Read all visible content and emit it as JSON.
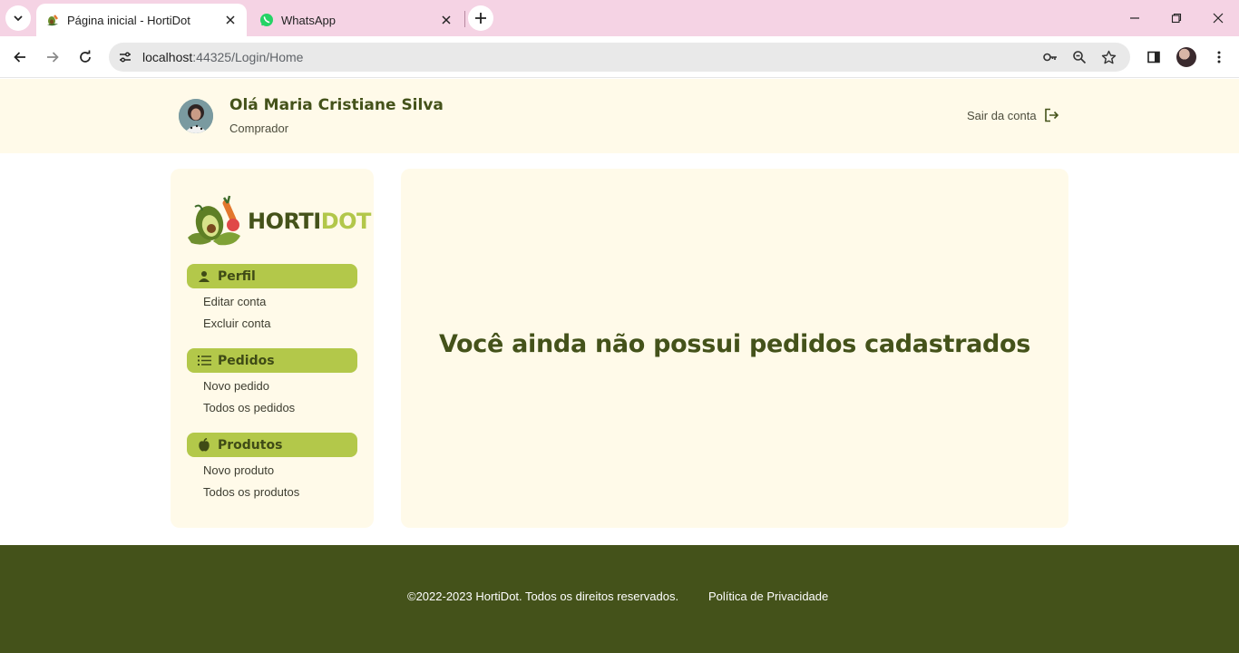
{
  "browser": {
    "tabs": [
      {
        "title": "Página inicial - HortiDot",
        "active": true,
        "icon": "hortidot-favicon"
      },
      {
        "title": "WhatsApp",
        "active": false,
        "icon": "whatsapp-icon"
      }
    ],
    "address": {
      "host": "localhost",
      "rest": ":44325/Login/Home"
    }
  },
  "header": {
    "greeting": "Olá Maria Cristiane Silva",
    "role": "Comprador",
    "logout_label": "Sair da conta"
  },
  "sidebar": {
    "logo": {
      "part1": "HORTI",
      "part2": "DOT"
    },
    "sections": [
      {
        "label": "Perfil",
        "icon": "user-icon",
        "items": [
          "Editar conta",
          "Excluir conta"
        ]
      },
      {
        "label": "Pedidos",
        "icon": "list-icon",
        "items": [
          "Novo pedido",
          "Todos os pedidos"
        ]
      },
      {
        "label": "Produtos",
        "icon": "apple-icon",
        "items": [
          "Novo produto",
          "Todos os produtos"
        ]
      }
    ]
  },
  "main": {
    "empty_message": "Você ainda não possui pedidos cadastrados"
  },
  "footer": {
    "copyright": "©2022-2023 HortiDot. Todos os direitos reservados.",
    "privacy": "Política de Privacidade"
  },
  "colors": {
    "header_bg": "#fffae9",
    "accent_green": "#b3c84a",
    "dark_green": "#44521a",
    "tabbar_pink": "#f5d3e4"
  }
}
